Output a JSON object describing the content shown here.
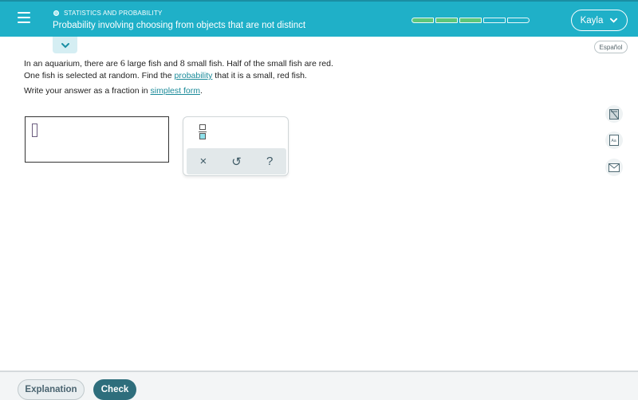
{
  "header": {
    "topic": "STATISTICS AND PROBABILITY",
    "title": "Probability involving choosing from objects that are not distinct",
    "progress": {
      "filled": 3,
      "total": 5
    },
    "user": {
      "name": "Kayla"
    },
    "colors": {
      "header_bg": "#1fb0c8",
      "progress_fill": "#5cc67a"
    }
  },
  "language_button": "Español",
  "question": {
    "line1_a": "In an aquarium, there are ",
    "num_large": "6",
    "line1_b": " large fish and ",
    "num_small": "8",
    "line1_c": " small fish. Half of the small fish are red.",
    "line2_a": "One fish is selected at random. Find the ",
    "line2_link": "probability",
    "line2_b": " that it is a small, red fish.",
    "instr_a": "Write your answer as a fraction in ",
    "instr_link": "simplest form",
    "instr_b": "."
  },
  "answer": {
    "value": ""
  },
  "keypad": {
    "clear": "×",
    "undo": "↺",
    "help": "?"
  },
  "side_tools": [
    "calculator-icon",
    "glossary-icon",
    "message-icon"
  ],
  "footer": {
    "explanation": "Explanation",
    "check": "Check"
  }
}
